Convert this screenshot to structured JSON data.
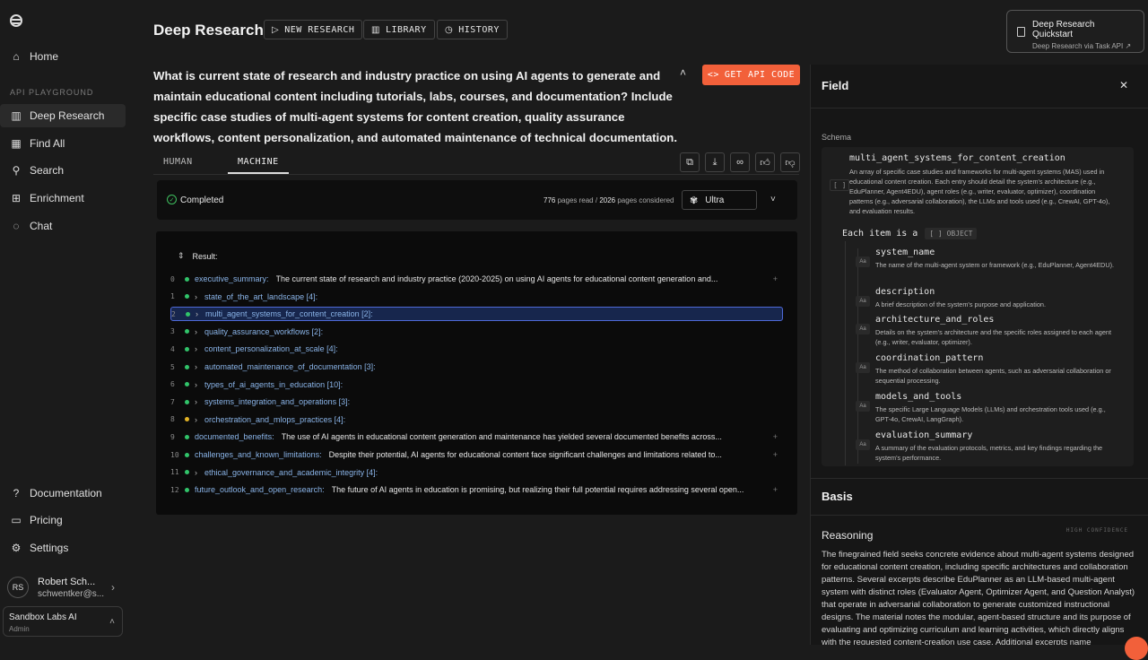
{
  "sidebar": {
    "items_top": [
      {
        "label": "Home",
        "icon": "home-icon"
      }
    ],
    "section_label": "API PLAYGROUND",
    "playground": [
      {
        "label": "Deep Research",
        "icon": "book-icon",
        "active": true
      },
      {
        "label": "Find All",
        "icon": "grid-icon"
      },
      {
        "label": "Search",
        "icon": "search-icon"
      },
      {
        "label": "Enrichment",
        "icon": "plus-grid-icon"
      },
      {
        "label": "Chat",
        "icon": "chat-icon"
      }
    ],
    "bottom": [
      {
        "label": "Documentation",
        "icon": "help-icon"
      },
      {
        "label": "Pricing",
        "icon": "money-icon"
      },
      {
        "label": "Settings",
        "icon": "gear-icon"
      }
    ],
    "user": {
      "initials": "RS",
      "name": "Robert Sch...",
      "email": "schwentker@s..."
    },
    "org": {
      "name": "Sandbox Labs AI",
      "role": "Admin"
    }
  },
  "header": {
    "title": "Deep Research",
    "buttons": [
      "NEW RESEARCH",
      "LIBRARY",
      "HISTORY"
    ],
    "quickstart": {
      "title": "Deep Research Quickstart",
      "subtitle": "Deep Research via Task API"
    }
  },
  "question": "What is current state of research and industry practice on using AI agents to generate and maintain educational content including tutorials, labs, courses, and documentation? Include specific case studies of multi-agent systems for content creation, quality assurance workflows, content personalization, and automated maintenance of technical documentation.",
  "api_button": "GET API CODE",
  "tabs": [
    "HUMAN",
    "MACHINE"
  ],
  "status": {
    "label": "Completed",
    "pages_read": "776",
    "pages_read_suffix": "pages read /",
    "pages_considered": "2026",
    "pages_considered_suffix": "pages considered",
    "processor": "Ultra"
  },
  "result": {
    "heading": "Result:",
    "rows": [
      {
        "num": "0",
        "key": "executive_summary:",
        "value": "The current state of research and industry practice (2020-2025) on using AI agents for educational content generation and...",
        "dot": "green",
        "expandable": false
      },
      {
        "num": "1",
        "key": "state_of_the_art_landscape [4]:",
        "value": "",
        "dot": "green",
        "expandable": true
      },
      {
        "num": "2",
        "key": "multi_agent_systems_for_content_creation [2]:",
        "value": "",
        "dot": "green",
        "expandable": true,
        "selected": true
      },
      {
        "num": "3",
        "key": "quality_assurance_workflows [2]:",
        "value": "",
        "dot": "green",
        "expandable": true
      },
      {
        "num": "4",
        "key": "content_personalization_at_scale [4]:",
        "value": "",
        "dot": "green",
        "expandable": true
      },
      {
        "num": "5",
        "key": "automated_maintenance_of_documentation [3]:",
        "value": "",
        "dot": "green",
        "expandable": true
      },
      {
        "num": "6",
        "key": "types_of_ai_agents_in_education [10]:",
        "value": "",
        "dot": "green",
        "expandable": true
      },
      {
        "num": "7",
        "key": "systems_integration_and_operations [3]:",
        "value": "",
        "dot": "green",
        "expandable": true
      },
      {
        "num": "8",
        "key": "orchestration_and_mlops_practices [4]:",
        "value": "",
        "dot": "yellow",
        "expandable": true
      },
      {
        "num": "9",
        "key": "documented_benefits:",
        "value": "The use of AI agents in educational content generation and maintenance has yielded several documented benefits across...",
        "dot": "green",
        "expandable": false
      },
      {
        "num": "10",
        "key": "challenges_and_known_limitations:",
        "value": "Despite their potential, AI agents for educational content face significant challenges and limitations related to...",
        "dot": "green",
        "expandable": false
      },
      {
        "num": "11",
        "key": "ethical_governance_and_academic_integrity [4]:",
        "value": "",
        "dot": "green",
        "expandable": true
      },
      {
        "num": "12",
        "key": "future_outlook_and_open_research:",
        "value": "The future of AI agents in education is promising, but realizing their full potential requires addressing several open...",
        "dot": "green",
        "expandable": false
      }
    ]
  },
  "field_panel": {
    "title": "Field",
    "schema_label": "Schema",
    "array_badge": "[ ]",
    "schema_name": "multi_agent_systems_for_content_creation",
    "schema_desc": "An array of specific case studies and frameworks for multi-agent systems (MAS) used in educational content creation. Each entry should detail the system's architecture (e.g., EduPlanner, Agent4EDU), agent roles (e.g., writer, evaluator, optimizer), coordination patterns (e.g., adversarial collaboration), the LLMs and tools used (e.g., CrewAI, GPT-4o), and evaluation results.",
    "each_item": "Each item is a",
    "object_badge": "[ ] OBJECT",
    "type_badge": "Aa",
    "fields": [
      {
        "name": "system_name",
        "desc": "The name of the multi-agent system or framework (e.g., EduPlanner, Agent4EDU)."
      },
      {
        "name": "description",
        "desc": "A brief description of the system's purpose and application."
      },
      {
        "name": "architecture_and_roles",
        "desc": "Details on the system's architecture and the specific roles assigned to each agent (e.g., writer, evaluator, optimizer)."
      },
      {
        "name": "coordination_pattern",
        "desc": "The method of collaboration between agents, such as adversarial collaboration or sequential processing."
      },
      {
        "name": "models_and_tools",
        "desc": "The specific Large Language Models (LLMs) and orchestration tools used (e.g., GPT-4o, CrewAI, LangGraph)."
      },
      {
        "name": "evaluation_summary",
        "desc": "A summary of the evaluation protocols, metrics, and key findings regarding the system's performance."
      }
    ],
    "basis_title": "Basis",
    "reasoning_title": "Reasoning",
    "confidence": "HIGH CONFIDENCE",
    "reasoning_text": "The finegrained field seeks concrete evidence about multi-agent systems designed for educational content creation, including specific architectures and collaboration patterns. Several excerpts describe EduPlanner as an LLM-based multi-agent system with distinct roles (Evaluator Agent, Optimizer Agent, and Question Analyst) that operate in adversarial collaboration to generate customized instructional designs. The material notes the modular, agent-based structure and its purpose of evaluating and optimizing curriculum and learning activities, which directly aligns with the requested content-creation use case. Additional excerpts name EducationQ as a multi-agent..."
  },
  "colors": {
    "accent": "#f2603a",
    "selected_border": "#4f6ad8",
    "key": "#8ab4e8",
    "ok": "#31c46a",
    "warn": "#e3b325"
  }
}
